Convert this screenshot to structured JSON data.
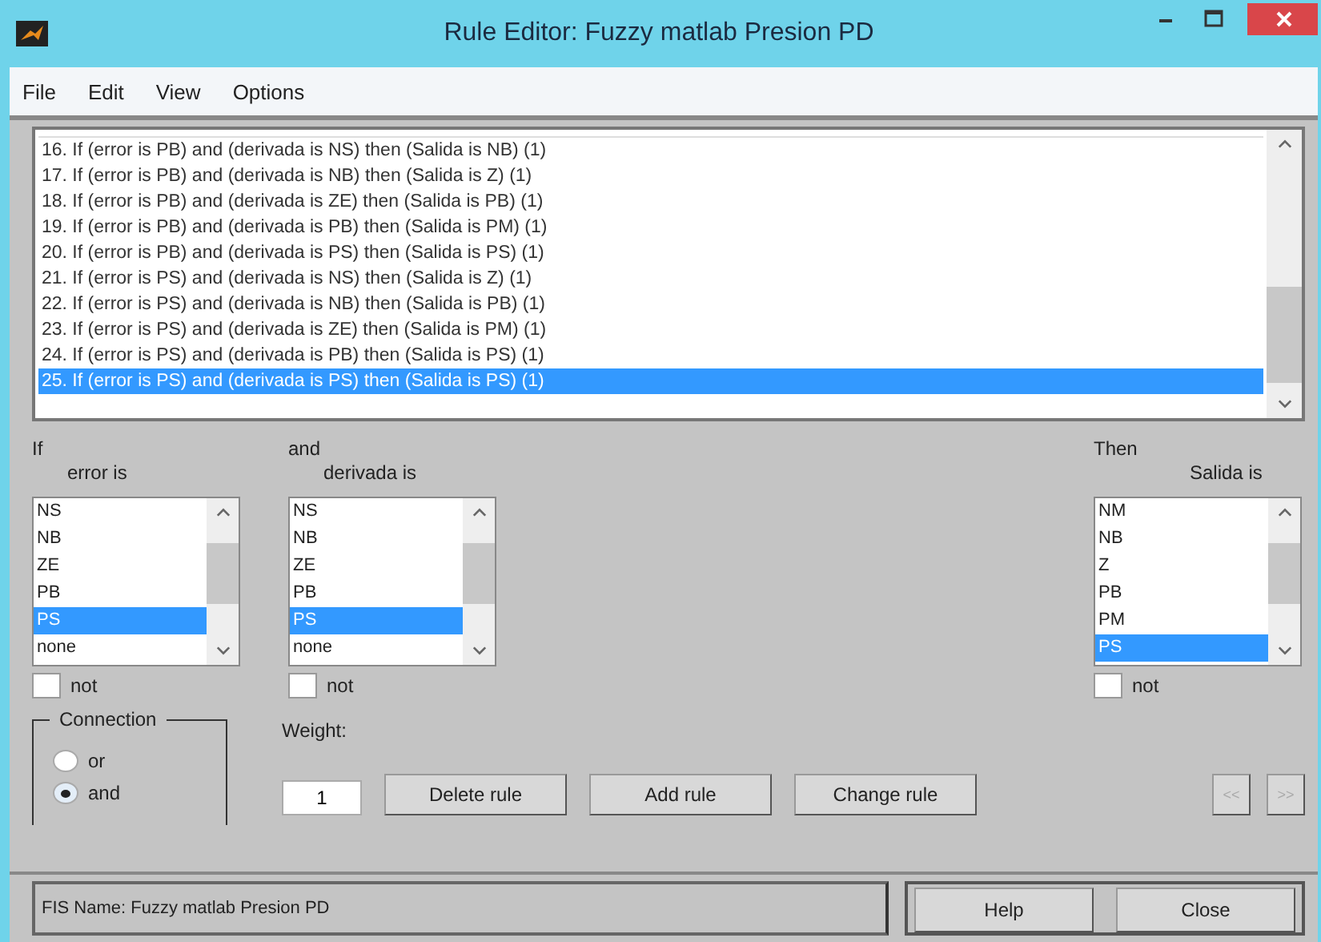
{
  "window": {
    "title": "Rule Editor: Fuzzy matlab Presion PD"
  },
  "menu": [
    "File",
    "Edit",
    "View",
    "Options"
  ],
  "rules": [
    {
      "text": "16. If (error is PB) and (derivada is NS) then (Salida is NB) (1)",
      "selected": false
    },
    {
      "text": "17. If (error is PB) and (derivada is NB) then (Salida is Z) (1)",
      "selected": false
    },
    {
      "text": "18. If (error is PB) and (derivada is ZE) then (Salida is PB) (1)",
      "selected": false
    },
    {
      "text": "19. If (error is PB) and (derivada is PB) then (Salida is PM) (1)",
      "selected": false
    },
    {
      "text": "20. If (error is PB) and (derivada is PS) then (Salida is PS) (1)",
      "selected": false
    },
    {
      "text": "21. If (error is PS) and (derivada is NS) then (Salida is Z) (1)",
      "selected": false
    },
    {
      "text": "22. If (error is PS) and (derivada is NB) then (Salida is PB) (1)",
      "selected": false
    },
    {
      "text": "23. If (error is PS) and (derivada is ZE) then (Salida is PM) (1)",
      "selected": false
    },
    {
      "text": "24. If (error is PS) and (derivada is PB) then (Salida is PS) (1)",
      "selected": false
    },
    {
      "text": "25. If (error is PS) and (derivada is PS) then (Salida is PS) (1)",
      "selected": true
    }
  ],
  "variables": [
    {
      "connector": "If",
      "label": "error is",
      "options": [
        {
          "label": "NS",
          "selected": false
        },
        {
          "label": "NB",
          "selected": false
        },
        {
          "label": "ZE",
          "selected": false
        },
        {
          "label": "PB",
          "selected": false
        },
        {
          "label": "PS",
          "selected": true
        },
        {
          "label": "none",
          "selected": false
        }
      ],
      "not_label": "not",
      "not_checked": false
    },
    {
      "connector": "and",
      "label": "derivada is",
      "options": [
        {
          "label": "NS",
          "selected": false
        },
        {
          "label": "NB",
          "selected": false
        },
        {
          "label": "ZE",
          "selected": false
        },
        {
          "label": "PB",
          "selected": false
        },
        {
          "label": "PS",
          "selected": true
        },
        {
          "label": "none",
          "selected": false
        }
      ],
      "not_label": "not",
      "not_checked": false
    }
  ],
  "output": {
    "connector": "Then",
    "label": "Salida is",
    "options": [
      {
        "label": "NM",
        "selected": false
      },
      {
        "label": "NB",
        "selected": false
      },
      {
        "label": "Z",
        "selected": false
      },
      {
        "label": "PB",
        "selected": false
      },
      {
        "label": "PM",
        "selected": false
      },
      {
        "label": "PS",
        "selected": true
      }
    ],
    "not_label": "not",
    "not_checked": false
  },
  "connection": {
    "title": "Connection",
    "options": [
      {
        "label": "or",
        "selected": false
      },
      {
        "label": "and",
        "selected": true
      }
    ]
  },
  "weight": {
    "label": "Weight:",
    "value": "1"
  },
  "buttons": [
    {
      "label": "Delete rule"
    },
    {
      "label": "Add rule"
    },
    {
      "label": "Change rule"
    }
  ],
  "nav_buttons": [
    {
      "label": "<<",
      "disabled": true
    },
    {
      "label": ">>",
      "disabled": true
    }
  ],
  "status": "FIS Name: Fuzzy matlab Presion PD",
  "footer_buttons": [
    {
      "label": "Help"
    },
    {
      "label": "Close"
    }
  ]
}
